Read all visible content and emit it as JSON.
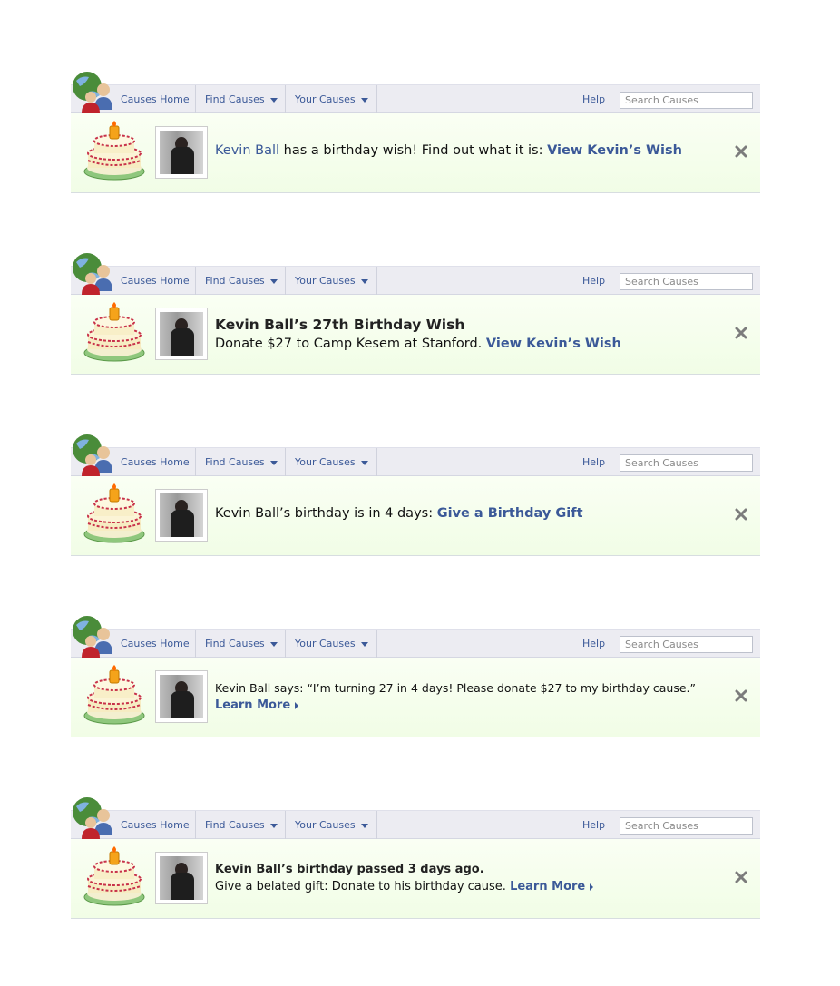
{
  "nav": {
    "home": "Causes Home",
    "find": "Find Causes",
    "your": "Your Causes",
    "help": "Help",
    "search_placeholder": "Search Causes"
  },
  "variants": [
    {
      "name_link": "Kevin Ball",
      "text": " has a birthday wish! Find out what it is: ",
      "cta": "View Kevin’s Wish"
    },
    {
      "heading": "Kevin Ball’s 27th Birthday Wish",
      "text": "Donate $27 to Camp Kesem at Stanford. ",
      "cta": "View Kevin’s Wish"
    },
    {
      "text": "Kevin Ball’s birthday is in 4 days: ",
      "cta": "Give a Birthday Gift"
    },
    {
      "text": "Kevin Ball says: “I’m turning 27 in 4 days! Please donate $27 to my birthday cause.”",
      "cta": "Learn More"
    },
    {
      "heading": "Kevin Ball’s birthday passed 3 days ago.",
      "text": "Give a belated gift: Donate to his birthday cause. ",
      "cta": "Learn More"
    }
  ],
  "icons": {
    "logo": "globe-people-icon",
    "cake": "birthday-cake-icon",
    "close": "close-icon",
    "caret": "chevron-down-icon"
  }
}
